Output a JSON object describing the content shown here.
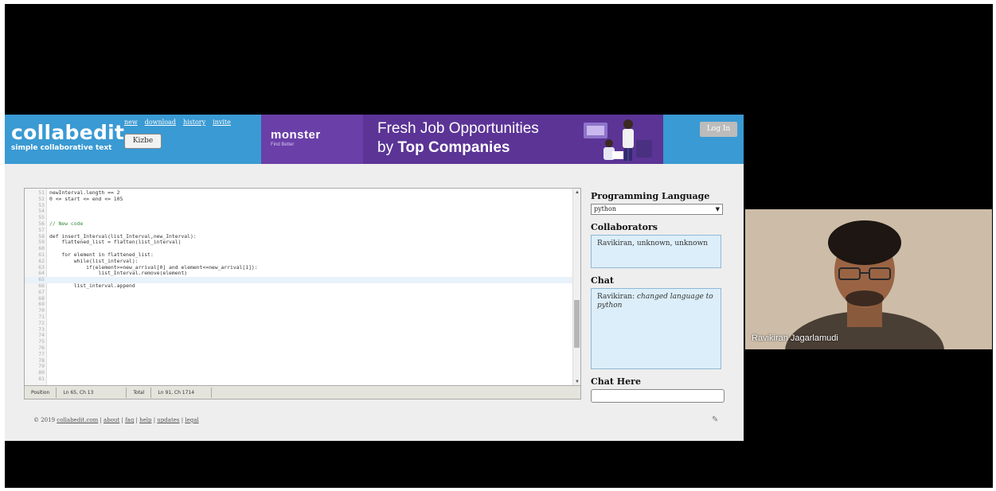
{
  "app": {
    "logo_title": "collabedit",
    "logo_subtitle": "simple collaborative text",
    "top_links": [
      "new",
      "download",
      "history",
      "invite"
    ],
    "code_button": "Kizbe",
    "login_button": "Log In"
  },
  "ad": {
    "brand": "monster",
    "tagline": "Find Better",
    "line1": "Fresh Job Opportunities",
    "line2_prefix": "by ",
    "line2_bold": "Top Companies"
  },
  "editor": {
    "lines": [
      {
        "n": "51",
        "code": "newInterval.length == 2"
      },
      {
        "n": "52",
        "code": "0 <= start <= end <= 105"
      },
      {
        "n": "53",
        "code": ""
      },
      {
        "n": "54",
        "code": ""
      },
      {
        "n": "55",
        "code": ""
      },
      {
        "n": "56",
        "code": "// New code"
      },
      {
        "n": "57",
        "code": ""
      },
      {
        "n": "58",
        "code": "def insert_Interval(list_Interval,new_Interval):"
      },
      {
        "n": "59",
        "code": "    flattened_list = flatten(list_interval)"
      },
      {
        "n": "60",
        "code": ""
      },
      {
        "n": "61",
        "code": "    for element in flattened_list:"
      },
      {
        "n": "62",
        "code": "        while(list_interval):"
      },
      {
        "n": "63",
        "code": "            if(element>=new_arrival[0] and element<=new_arrival[1]):"
      },
      {
        "n": "64",
        "code": "                list_Interval.remove(element)"
      },
      {
        "n": "65",
        "code": ""
      },
      {
        "n": "66",
        "code": "        list_interval.append"
      },
      {
        "n": "67",
        "code": ""
      },
      {
        "n": "68",
        "code": ""
      },
      {
        "n": "69",
        "code": ""
      },
      {
        "n": "70",
        "code": ""
      },
      {
        "n": "71",
        "code": ""
      },
      {
        "n": "72",
        "code": ""
      },
      {
        "n": "73",
        "code": ""
      },
      {
        "n": "74",
        "code": ""
      },
      {
        "n": "75",
        "code": ""
      },
      {
        "n": "76",
        "code": ""
      },
      {
        "n": "77",
        "code": ""
      },
      {
        "n": "78",
        "code": ""
      },
      {
        "n": "79",
        "code": ""
      },
      {
        "n": "80",
        "code": ""
      },
      {
        "n": "81",
        "code": ""
      }
    ],
    "status": {
      "position_label": "Position",
      "position_value": "Ln 65, Ch 13",
      "total_label": "Total",
      "total_value": "Ln 91, Ch 1714"
    }
  },
  "side": {
    "lang_heading": "Programming Language",
    "lang_value": "python",
    "collab_heading": "Collaborators",
    "collab_value": "Ravikiran, unknown, unknown",
    "chat_heading": "Chat",
    "chat_author": "Ravikiran:",
    "chat_message": "changed language to python",
    "chat_here_heading": "Chat Here"
  },
  "footer": {
    "copyright": "© 2019",
    "links": [
      "collabedit.com",
      "about",
      "faq",
      "help",
      "updates",
      "legal"
    ]
  },
  "video": {
    "participant_name": "Ravikiran Jagarlamudi"
  }
}
